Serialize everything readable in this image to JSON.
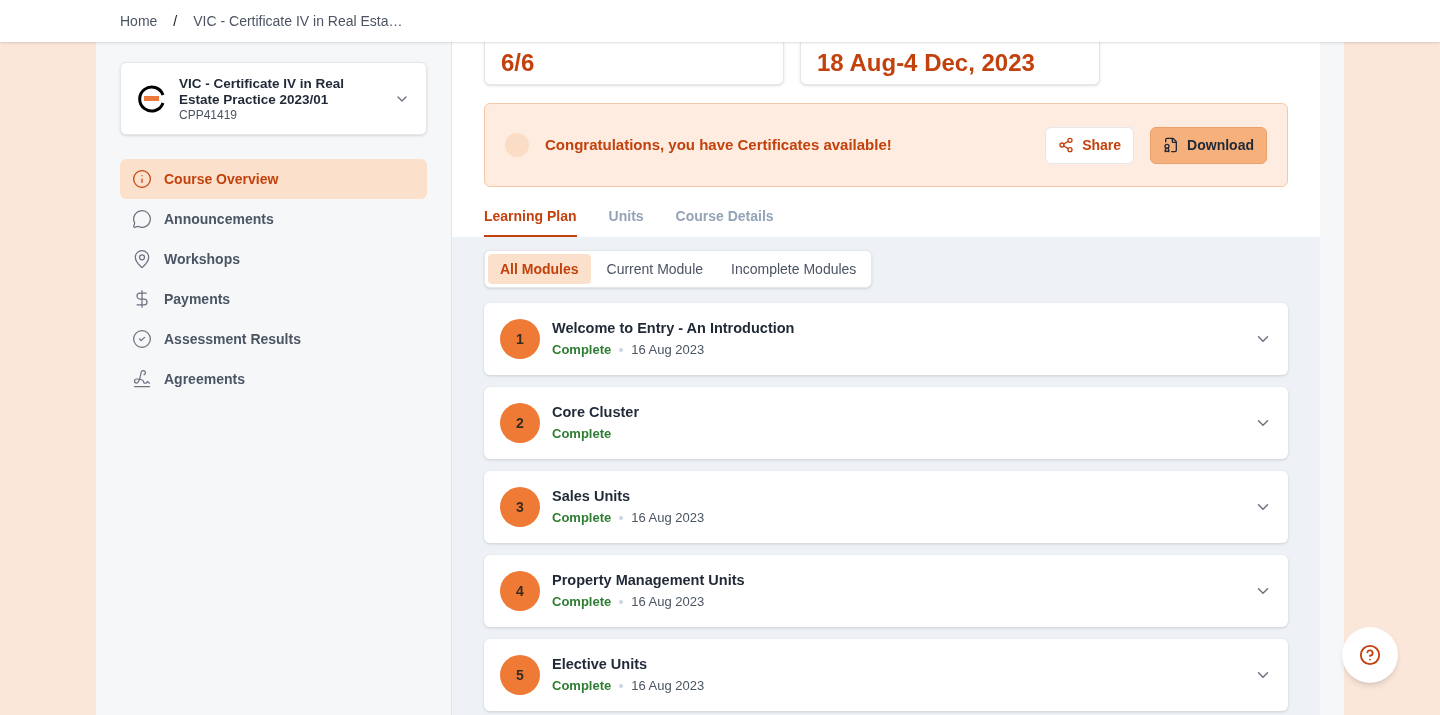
{
  "breadcrumb": {
    "items": [
      "Home",
      "VIC - Certificate IV in Real Esta…"
    ],
    "separator": "/"
  },
  "course": {
    "title": "VIC - Certificate IV in Real Estate Practice 2023/01",
    "code": "CPP41419"
  },
  "sidebar": {
    "items": [
      {
        "label": "Course Overview",
        "kind": "info",
        "selected": true
      },
      {
        "label": "Announcements",
        "kind": "chat",
        "selected": false
      },
      {
        "label": "Workshops",
        "kind": "pin",
        "selected": false
      },
      {
        "label": "Payments",
        "kind": "dollar",
        "selected": false
      },
      {
        "label": "Assessment Results",
        "kind": "check",
        "selected": false
      },
      {
        "label": "Agreements",
        "kind": "sign",
        "selected": false
      }
    ]
  },
  "stats": [
    "6/6",
    "18 Aug-4 Dec, 2023"
  ],
  "banner": {
    "message": "Congratulations, you have Certificates available!",
    "buttons": [
      {
        "label": "Share",
        "kind": "secondary"
      },
      {
        "label": "Download",
        "kind": "primary"
      }
    ]
  },
  "tabs": [
    {
      "label": "Learning Plan",
      "selected": true
    },
    {
      "label": "Units",
      "selected": false
    },
    {
      "label": "Course Details",
      "selected": false
    }
  ],
  "filters": [
    {
      "label": "All Modules",
      "selected": true
    },
    {
      "label": "Current Module",
      "selected": false
    },
    {
      "label": "Incomplete Modules",
      "selected": false
    }
  ],
  "modules": [
    {
      "number": "1",
      "title": "Welcome to Entry - An Introduction",
      "status": "Complete",
      "date": "16 Aug 2023"
    },
    {
      "number": "2",
      "title": "Core Cluster",
      "status": "Complete"
    },
    {
      "number": "3",
      "title": "Sales Units",
      "status": "Complete",
      "date": "16 Aug 2023"
    },
    {
      "number": "4",
      "title": "Property Management Units",
      "status": "Complete",
      "date": "16 Aug 2023"
    },
    {
      "number": "5",
      "title": "Elective Units",
      "status": "Complete",
      "date": "16 Aug 2023"
    }
  ]
}
